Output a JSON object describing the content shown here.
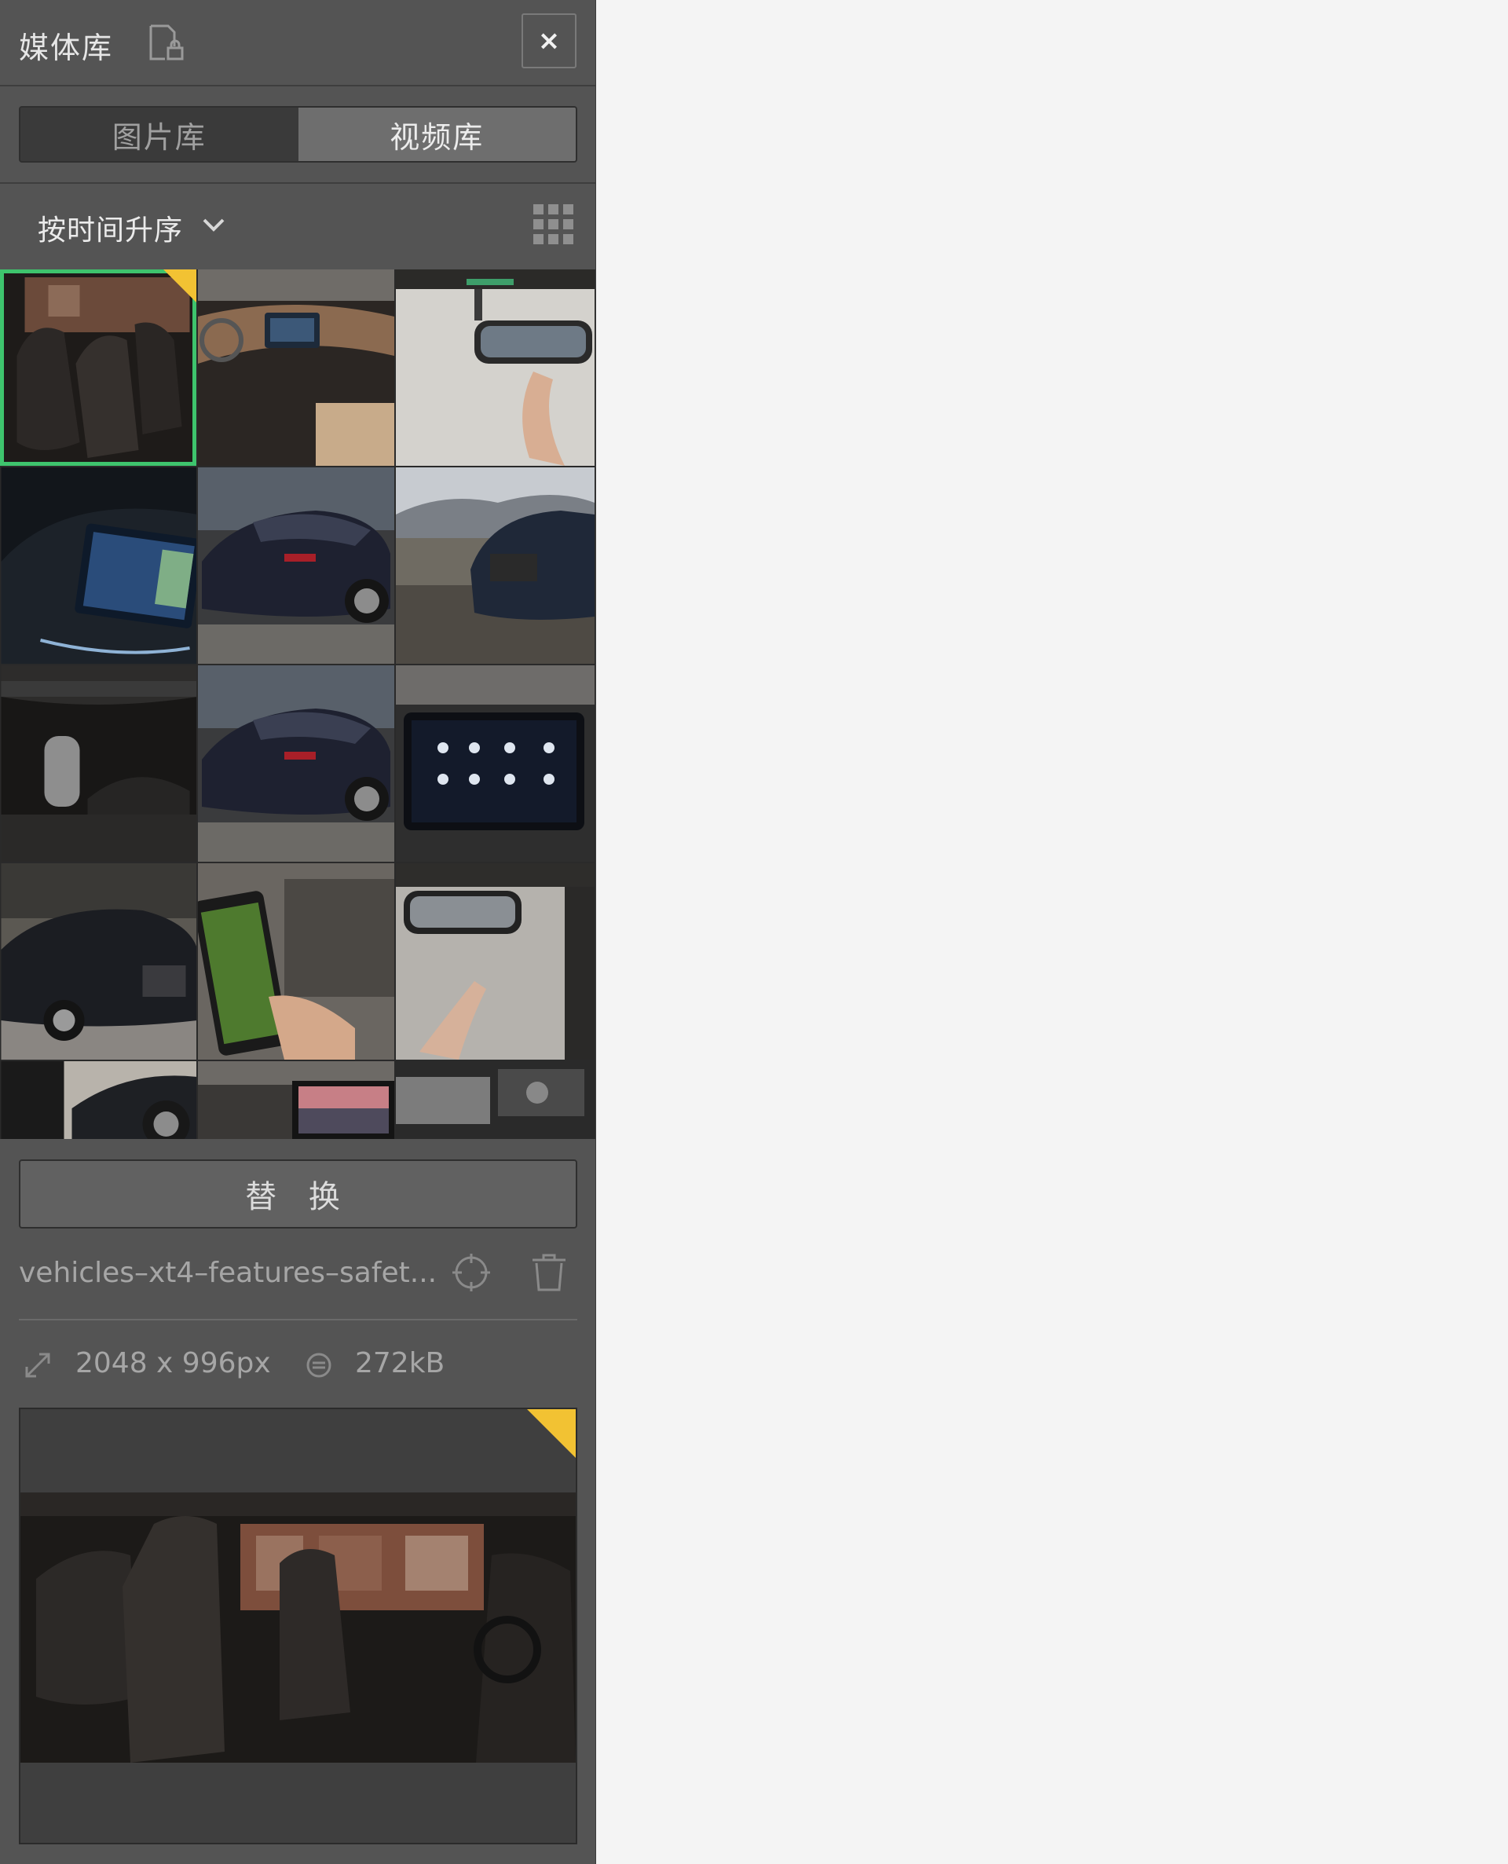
{
  "panel": {
    "title": "媒体库",
    "close_label": "×"
  },
  "tabs": [
    {
      "label": "图片库",
      "active": false
    },
    {
      "label": "视频库",
      "active": true
    }
  ],
  "sort": {
    "label": "按时间升序"
  },
  "gallery": {
    "selected_index": 0,
    "items": [
      {
        "scene": "car-seat-interior"
      },
      {
        "scene": "dashboard-console"
      },
      {
        "scene": "rearview-mirror-hand"
      },
      {
        "scene": "infotainment-screen-dark"
      },
      {
        "scene": "dark-sedan-rear"
      },
      {
        "scene": "suv-front-road"
      },
      {
        "scene": "gear-shifter"
      },
      {
        "scene": "dark-sedan-rear"
      },
      {
        "scene": "touchscreen-menu"
      },
      {
        "scene": "black-sedan-front"
      },
      {
        "scene": "tablet-hand"
      },
      {
        "scene": "mirror-hand-street"
      },
      {
        "scene": "person-by-car"
      },
      {
        "scene": "dash-display-sunset"
      },
      {
        "scene": "engine-bay"
      }
    ]
  },
  "actions": {
    "replace_label": "替 换"
  },
  "details": {
    "filename": "vehicles–xt4–features–safet...",
    "dimensions": "2048 x 996px",
    "file_size": "272kB"
  },
  "colors": {
    "panel_bg": "#545454",
    "selection": "#3ec46d",
    "badge": "#f2c233"
  }
}
